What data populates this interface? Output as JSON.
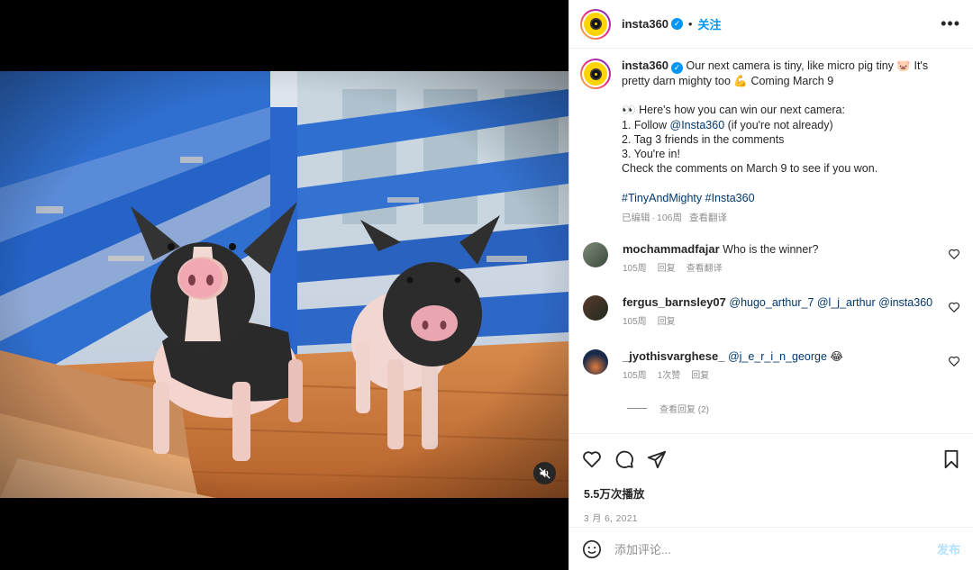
{
  "header": {
    "username": "insta360",
    "dot": "•",
    "follow_label": "关注",
    "more_label": "•••"
  },
  "caption": {
    "username": "insta360",
    "line1a": "Our next camera is tiny, like micro pig tiny",
    "line1b": "It's pretty darn mighty too",
    "line1c": "Coming March 9",
    "pig_emoji": "🐷",
    "arm_emoji": "💪",
    "eyes_emoji": "👀",
    "how_to": "Here's how you can win our next camera:",
    "step1_prefix": "1. Follow ",
    "step1_link": "@Insta360",
    "step1_suffix": " (if you're not already)",
    "step2": "2. Tag 3 friends in the comments",
    "step3": "3. You're in!",
    "check": "Check the comments on March 9 to see if you won.",
    "tags": "#TinyAndMighty #Insta360",
    "edited": "已编辑",
    "sep": "·",
    "age": "106周",
    "translate": "查看翻译"
  },
  "comments": [
    {
      "username": "mochammadfajar",
      "text": "Who is the winner?",
      "age": "105周",
      "reply": "回复",
      "translate": "查看翻译"
    },
    {
      "username": "fergus_barnsley07",
      "mentions": "@hugo_arthur_7 @l_j_arthur @insta360",
      "age": "105周",
      "reply": "回复"
    },
    {
      "username": "_jyothisvarghese_",
      "mentions": "@j_e_r_i_n_george",
      "emoji": "😂",
      "age": "105周",
      "likes": "1次赞",
      "reply": "回复"
    }
  ],
  "view_replies": "查看回复 (2)",
  "stats": {
    "plays": "5.5万次播放",
    "date": "3 月 6, 2021"
  },
  "composer": {
    "placeholder": "添加评论...",
    "post_label": "发布"
  },
  "icons": {
    "heart": "heart-icon",
    "comment": "comment-icon",
    "share": "send-icon",
    "save": "bookmark-icon",
    "mute": "muted-speaker-icon",
    "emoji": "emoji-icon"
  },
  "colors": {
    "accent": "#0095f6",
    "link": "#00376b",
    "muted": "#8e8e8e"
  }
}
